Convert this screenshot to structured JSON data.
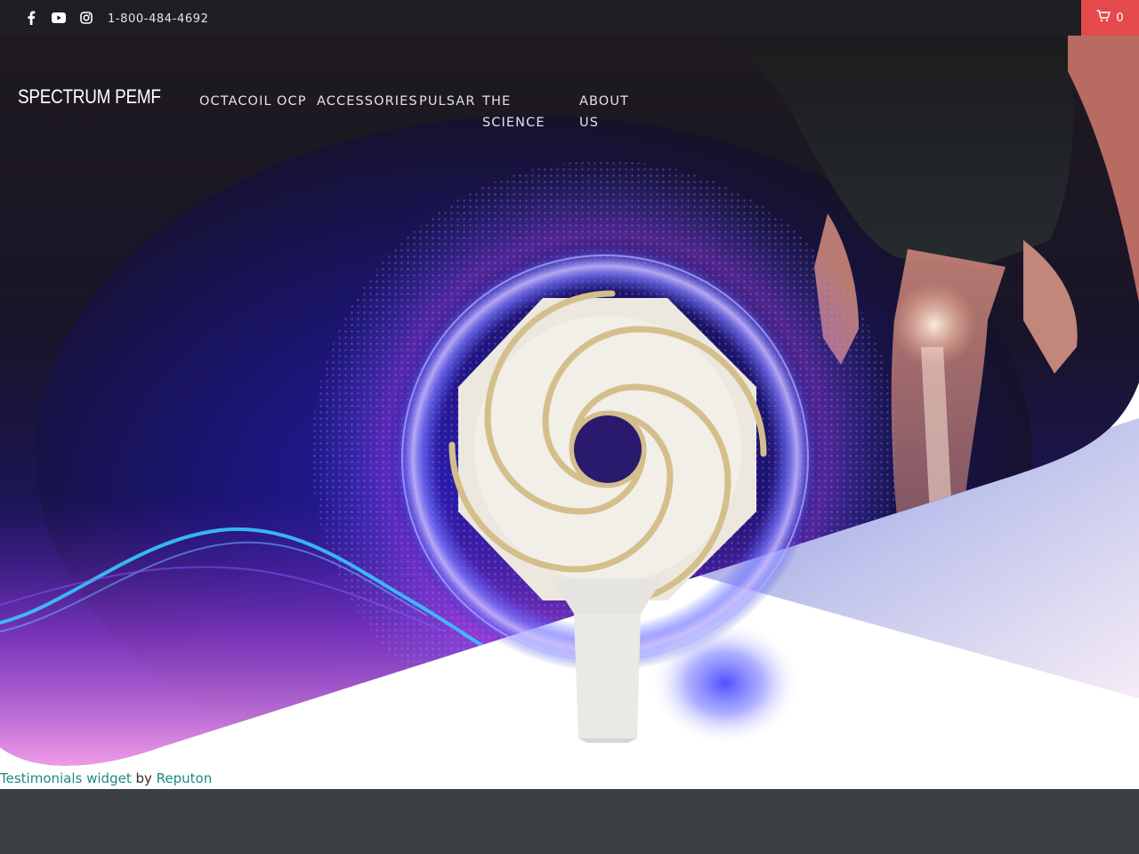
{
  "topbar": {
    "phone": "1-800-484-4692",
    "social": [
      "facebook-icon",
      "youtube-icon",
      "instagram-icon"
    ],
    "cart_count": "0",
    "cart_color": "#e44a4b",
    "bar_color": "#1d1f24"
  },
  "header": {
    "logo": "SPECTRUM PEMF",
    "nav": [
      {
        "label": "OCTACOIL"
      },
      {
        "label": "OCP"
      },
      {
        "label": "ACCESSORIES"
      },
      {
        "label": "PULSAR"
      },
      {
        "label": "THE SCIENCE"
      },
      {
        "label": "ABOUT US"
      }
    ]
  },
  "credit": {
    "widget_link": "Testimonials widget",
    "by": "by",
    "brand_link": "Reputon",
    "link_color": "#1d8a86"
  },
  "footer": {
    "color": "#3b3f42"
  }
}
